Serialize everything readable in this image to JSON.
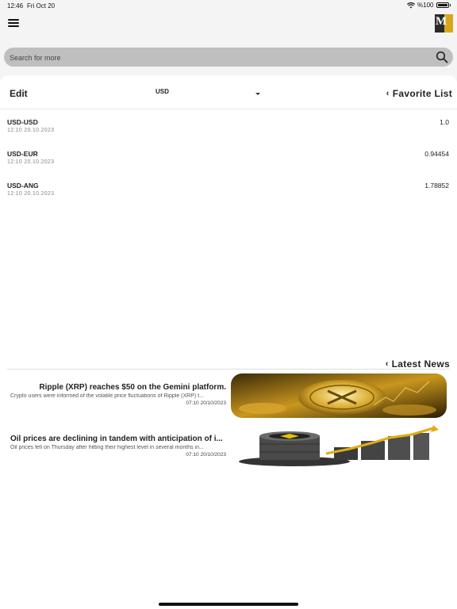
{
  "status_bar": {
    "time": "12:46",
    "date": "Fri Oct 20",
    "battery": "%100"
  },
  "search": {
    "placeholder": "Search for more"
  },
  "favorites": {
    "edit_label": "Edit",
    "currency": "USD",
    "title": "Favorite List",
    "rates": [
      {
        "pair": "USD-USD",
        "timestamp": "12:10 20.10.2023",
        "value": "1.0"
      },
      {
        "pair": "USD-EUR",
        "timestamp": "12:10 20.10.2023",
        "value": "0.94454"
      },
      {
        "pair": "USD-ANG",
        "timestamp": "12:10 20.10.2023",
        "value": "1.78852"
      }
    ]
  },
  "news": {
    "title": "Latest News",
    "items": [
      {
        "headline": "Ripple (XRP) reaches $50 on the Gemini platform.",
        "snippet": "Crypto users were informed of the volatile price fluctuations of Ripple (XRP) t...",
        "date": "07:10 20/10/2023",
        "image": "gold-xrp-coin"
      },
      {
        "headline": "Oil prices are declining in tandem with anticipation of i...",
        "snippet": "Oil prices fell on Thursday after hitting their highest level in several months in...",
        "date": "07:10 20/10/2023",
        "image": "oil-barrel-chart"
      }
    ]
  },
  "colors": {
    "accent_gold": "#d9a520",
    "search_bg": "#bfbfbf"
  }
}
